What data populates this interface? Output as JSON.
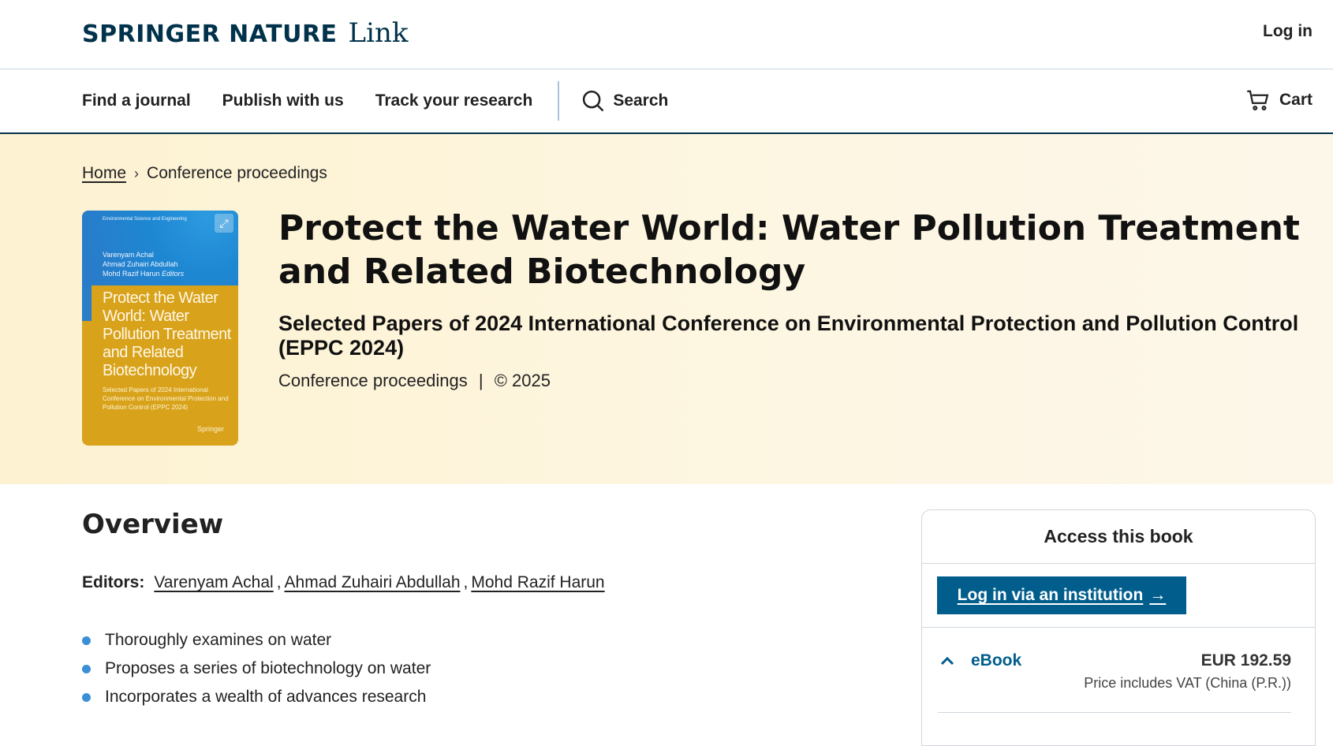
{
  "header": {
    "brand": "SPRINGER NATURE",
    "brand_sub": "Link",
    "login": "Log in"
  },
  "nav": {
    "items": [
      "Find a journal",
      "Publish with us",
      "Track your research"
    ],
    "search": "Search",
    "cart": "Cart"
  },
  "breadcrumb": {
    "home": "Home",
    "current": "Conference proceedings"
  },
  "cover": {
    "series": "Environmental Science and Engineering",
    "editors": [
      "Varenyam Achal",
      "Ahmad Zuhairi Abdullah",
      "Mohd Razif Harun"
    ],
    "editors_tag": "Editors",
    "title": "Protect the Water World: Water Pollution Treatment and Related Biotechnology",
    "subtitle": "Selected Papers of 2024 International Conference on Environmental Protection and Pollution Control (EPPC 2024)",
    "publisher": "Springer"
  },
  "book": {
    "title": "Protect the Water World: Water Pollution Treatment and Related Biotechnology",
    "subtitle": "Selected Papers of 2024 International Conference on Environmental Protection and Pollution Control (EPPC 2024)",
    "type": "Conference proceedings",
    "separator": "|",
    "year": "© 2025"
  },
  "overview": {
    "heading": "Overview",
    "editors_label": "Editors:",
    "editors": [
      "Varenyam Achal",
      "Ahmad Zuhairi Abdullah",
      "Mohd Razif Harun"
    ],
    "bullets": [
      "Thoroughly examines on water",
      "Proposes a series of biotechnology on water",
      "Incorporates a wealth of advances research"
    ]
  },
  "access": {
    "heading": "Access this book",
    "institution_button": "Log in via an institution",
    "ebook_label": "eBook",
    "price": "EUR 192.59",
    "vat": "Price includes VAT (China (P.R.))"
  },
  "colors": {
    "brand": "#01324b",
    "primary_button": "#015e8c",
    "hero_bg": "#fdf2d1",
    "bullet": "#3a8fd6"
  }
}
